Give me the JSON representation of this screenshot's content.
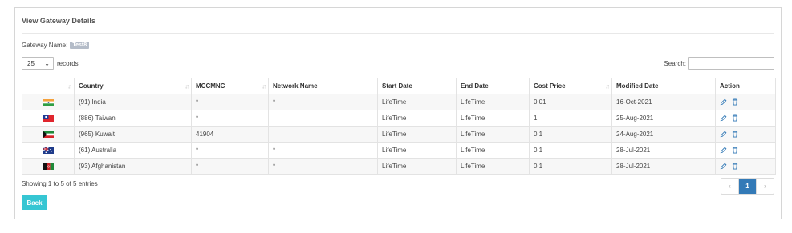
{
  "panel": {
    "title": "View Gateway Details"
  },
  "gateway": {
    "label": "Gateway Name:",
    "value": "Test8"
  },
  "length": {
    "value": "25",
    "suffix": "records"
  },
  "search": {
    "label": "Search:",
    "value": ""
  },
  "table": {
    "headers": [
      "",
      "Country",
      "MCCMNC",
      "Network Name",
      "Start Date",
      "End Date",
      "Cost Price",
      "Modified Date",
      "Action"
    ],
    "rows": [
      {
        "flag": "india",
        "country": "(91) India",
        "mccmnc": "*",
        "network": "*",
        "start": "LifeTime",
        "end": "LifeTime",
        "cost": "0.01",
        "modified": "16-Oct-2021"
      },
      {
        "flag": "taiwan",
        "country": "(886) Taiwan",
        "mccmnc": "*",
        "network": "",
        "start": "LifeTime",
        "end": "LifeTime",
        "cost": "1",
        "modified": "25-Aug-2021"
      },
      {
        "flag": "kuwait",
        "country": "(965) Kuwait",
        "mccmnc": "41904",
        "network": "",
        "start": "LifeTime",
        "end": "LifeTime",
        "cost": "0.1",
        "modified": "24-Aug-2021"
      },
      {
        "flag": "australia",
        "country": "(61) Australia",
        "mccmnc": "*",
        "network": "*",
        "start": "LifeTime",
        "end": "LifeTime",
        "cost": "0.1",
        "modified": "28-Jul-2021"
      },
      {
        "flag": "afghanistan",
        "country": "(93) Afghanistan",
        "mccmnc": "*",
        "network": "*",
        "start": "LifeTime",
        "end": "LifeTime",
        "cost": "0.1",
        "modified": "28-Jul-2021"
      }
    ]
  },
  "footer": {
    "info": "Showing 1 to 5 of 5 entries"
  },
  "pagination": {
    "prev": "‹",
    "page": "1",
    "next": "›"
  },
  "back_button": {
    "label": "Back"
  },
  "icons": {
    "edit": "pencil-icon",
    "delete": "trash-icon",
    "sort": "sort-icon",
    "dropdown": "chevron-down-icon"
  },
  "colors": {
    "accent": "#36c6d3",
    "page_active": "#337ab7",
    "badge": "#b4bcc8",
    "action_icon": "#337ab7"
  }
}
